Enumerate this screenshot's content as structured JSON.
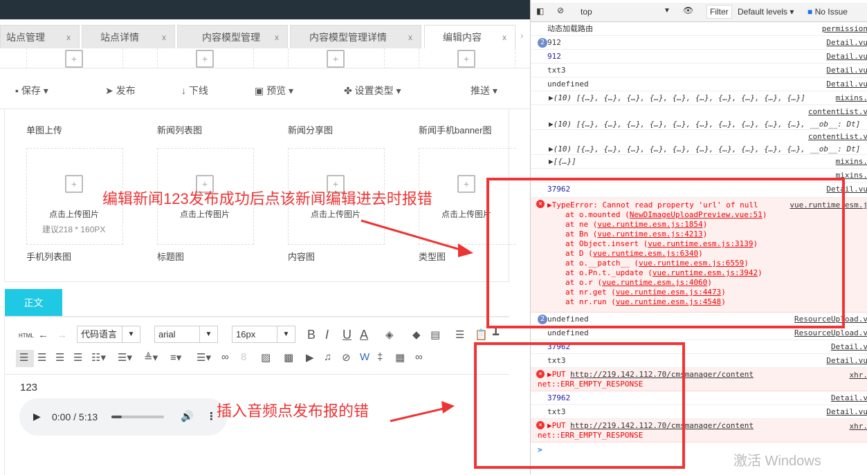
{
  "tabs": [
    {
      "label": "站点管理",
      "close": "x"
    },
    {
      "label": "站点详情",
      "close": "x"
    },
    {
      "label": "内容模型管理",
      "close": "x"
    },
    {
      "label": "内容模型管理详情",
      "close": "x"
    },
    {
      "label": "编辑内容",
      "close": "x",
      "active": true
    }
  ],
  "toolbar": {
    "save": "保存",
    "publish": "发布",
    "offline": "下线",
    "preview": "预览",
    "set_type": "设置类型",
    "push": "推送"
  },
  "image_fields_top": [
    "单图上传",
    "新闻列表图",
    "新闻分享图",
    "新闻手机banner图"
  ],
  "upload_text": "点击上传图片",
  "upload_hint": "建议218 * 160PX",
  "image_fields_bottom": [
    "手机列表图",
    "标题图",
    "内容图",
    "类型图"
  ],
  "editor": {
    "tab": "正文",
    "html_label": "HTML",
    "code_lang": "代码语言",
    "font": "arial",
    "size": "16px",
    "content": "123",
    "audio_time": "0:00 / 5:13",
    "audio_progress": 0.2
  },
  "annotations": {
    "first": "编辑新闻123发布成功后点该新闻编辑进去时报错",
    "second": "插入音频点发布报的错"
  },
  "devtools": {
    "context": "top",
    "filter": "Filter",
    "levels": "Default levels",
    "issues": "No Issue",
    "rows": [
      {
        "text": "动态加载路由",
        "src": "permission"
      },
      {
        "badge": "2",
        "text": "912",
        "src": "Detail.vu"
      },
      {
        "text": "912",
        "src": "Detail.vu",
        "blue": true
      },
      {
        "text": "txt3",
        "src": "Detail.vu"
      },
      {
        "text": "undefined",
        "src": "Detail.vu"
      },
      {
        "text": "▶(10) [{…}, {…}, {…}, {…}, {…}, {…}, {…}, {…}, {…}, {…}]",
        "src": "mixins."
      },
      {
        "text": "▶(10) [{…}, {…}, {…}, {…}, {…}, {…}, {…}, {…}, {…}, {…}, __ob__: Dt]",
        "src": "contentList.v"
      },
      {
        "text": "▶(10) [{…}, {…}, {…}, {…}, {…}, {…}, {…}, {…}, {…}, {…}, __ob__: Dt]",
        "src": "contentList.v"
      },
      {
        "text": "▶[{…}]",
        "src": "mixins."
      },
      {
        "text": "",
        "src": "mixins."
      },
      {
        "text": "37962",
        "src": "Detail.vu",
        "blue": true
      }
    ],
    "type_error": {
      "title": "▶TypeError: Cannot read property 'url' of null",
      "src": "vue.runtime.esm.j",
      "stack": [
        [
          "at o.mounted",
          "NewDImageUploadPreview.vue:51"
        ],
        [
          "at ne",
          "vue.runtime.esm.js:1854"
        ],
        [
          "at Bn",
          "vue.runtime.esm.js:4213"
        ],
        [
          "at Object.insert",
          "vue.runtime.esm.js:3139"
        ],
        [
          "at D",
          "vue.runtime.esm.js:6340"
        ],
        [
          "at o.__patch__",
          "vue.runtime.esm.js:6559"
        ],
        [
          "at o.Pn.t._update",
          "vue.runtime.esm.js:3942"
        ],
        [
          "at o.r",
          "vue.runtime.esm.js:4060"
        ],
        [
          "at nr.get",
          "vue.runtime.esm.js:4473"
        ],
        [
          "at nr.run",
          "vue.runtime.esm.js:4548"
        ]
      ]
    },
    "rows2": [
      {
        "badge": "2",
        "text": "undefined",
        "src": "ResourceUpload.v"
      },
      {
        "text": "undefined",
        "src": "ResourceUpload.v"
      },
      {
        "text": "37962",
        "src": "Detail.v",
        "blue": true
      },
      {
        "text": "txt3",
        "src": "Detail.vu"
      }
    ],
    "put_error": {
      "method": "▶PUT",
      "url": "http://219.142.112.70/cmsmanager/content",
      "msg": "net::ERR_EMPTY_RESPONSE",
      "src": "xhr."
    },
    "rows3": [
      {
        "text": "37962",
        "src": "Detail.v",
        "blue": true
      },
      {
        "text": "txt3",
        "src": "Detail.vu"
      }
    ],
    "prompt": ">"
  },
  "watermark": "激活 Windows",
  "colors": {
    "accent": "#1fc8e3",
    "annotation": "#f03434"
  }
}
